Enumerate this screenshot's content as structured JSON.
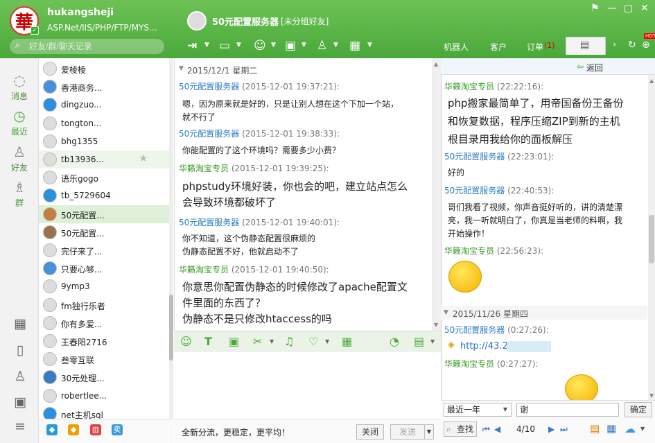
{
  "header": {
    "avatar_char": "華",
    "username": "hukangsheji",
    "signature": "ASP.Net/IIS/PHP/FTP/MYS...",
    "search_placeholder": "好友/群/聊天记录",
    "contact_name": "50元配置服务器",
    "contact_group": "[未分组好友]",
    "tabs": [
      {
        "label": "机器人"
      },
      {
        "label": "客户"
      },
      {
        "label": "订单",
        "badge": "(1)"
      }
    ],
    "hot_badge": "HOT",
    "colors": {
      "header_green": "#4aa83a",
      "badge_red": "#e00000"
    }
  },
  "leftnav": {
    "items": [
      {
        "label": "消息",
        "icon": "message-icon"
      },
      {
        "label": "最近",
        "icon": "clock-icon"
      },
      {
        "label": "好友",
        "icon": "person-icon"
      },
      {
        "label": "群",
        "icon": "group-icon"
      }
    ]
  },
  "contacts": [
    {
      "name": "爱棱棱"
    },
    {
      "name": "香港商务..."
    },
    {
      "name": "dingzuo..."
    },
    {
      "name": "tongton..."
    },
    {
      "name": "bhg1355"
    },
    {
      "name": "tb13936..."
    },
    {
      "name": "语乐gogo"
    },
    {
      "name": "tb_5729604"
    },
    {
      "name": "50元配置..."
    },
    {
      "name": "50元配置..."
    },
    {
      "name": "完仔来了..."
    },
    {
      "name": "只要心够..."
    },
    {
      "name": "9ymp3"
    },
    {
      "name": "fm独行乐者"
    },
    {
      "name": "你有多爱..."
    },
    {
      "name": "王春阳2716"
    },
    {
      "name": "叁零互联"
    },
    {
      "name": "30元处理..."
    },
    {
      "name": "robertlee..."
    },
    {
      "name": "net主机sql"
    }
  ],
  "chat": {
    "date": "2015/12/1 星期二",
    "messages": [
      {
        "sender": "50元配置服务器",
        "time": "(2015-12-01 19:37:21):",
        "lines": [
          "嗯，因为原来就是好的，只是让别人想在这个下加一个站，",
          "就不行了"
        ]
      },
      {
        "sender": "50元配置服务器",
        "time": "(2015-12-01 19:38:33):",
        "lines": [
          "你能配置的了这个环境吗？需要多少小费？"
        ]
      },
      {
        "sender": "华籁淘宝专员",
        "time": "(2015-12-01 19:39:25):",
        "lines": [
          "phpstudy环境好装，你也会的吧，建立站点怎么",
          "会导致环境都破坏了"
        ]
      },
      {
        "sender": "50元配置服务器",
        "time": "(2015-12-01 19:40:01):",
        "lines": [
          "你不知道，这个伪静态配置很麻烦的",
          "伪静态配置不好，他就启动不了"
        ]
      },
      {
        "sender": "华籁淘宝专员",
        "time": "(2015-12-01 19:40:50):",
        "lines": [
          "你意思你配置伪静态的时候修改了apache配置文",
          "件里面的东西了？",
          "伪静态不是只修改htaccess的吗"
        ]
      }
    ]
  },
  "bottom": {
    "slogan": "全新分流，更稳定，更平均！",
    "close_label": "关闭",
    "send_label": "发送"
  },
  "history": {
    "back_label": "返回",
    "messages": [
      {
        "sender": "华籁淘宝专员",
        "time": "(22:22:16):",
        "lines": [
          "php搬家最简单了，用帝国备份王备份",
          "和恢复数据，程序压缩ZIP到新的主机",
          "根目录用我给你的面板解压"
        ]
      },
      {
        "sender": "50元配置服务器",
        "time": "(22:23:01):",
        "lines": [
          "好的"
        ]
      },
      {
        "sender": "50元配置服务器",
        "time": "(22:40:53):",
        "lines": [
          "哥们我看了视频，你声音挺好听的，讲的清楚漂",
          "亮，我一听就明白了，你真是当老师的料啊，我",
          "开始操作！"
        ]
      },
      {
        "sender": "华籁淘宝专员",
        "time": "(22:56:23):",
        "lines": []
      },
      {
        "sender": "50元配置服务器",
        "time": "(0:27:26):",
        "lines": [
          "http://43.2"
        ]
      },
      {
        "sender": "华籁淘宝专员",
        "time": "(0:27:27):",
        "lines": []
      }
    ],
    "date2": "2015/11/26 星期四",
    "range_select": "最近一年",
    "keyword": "谢",
    "confirm_label": "确定",
    "find_label": "查找",
    "page": "4/10"
  }
}
